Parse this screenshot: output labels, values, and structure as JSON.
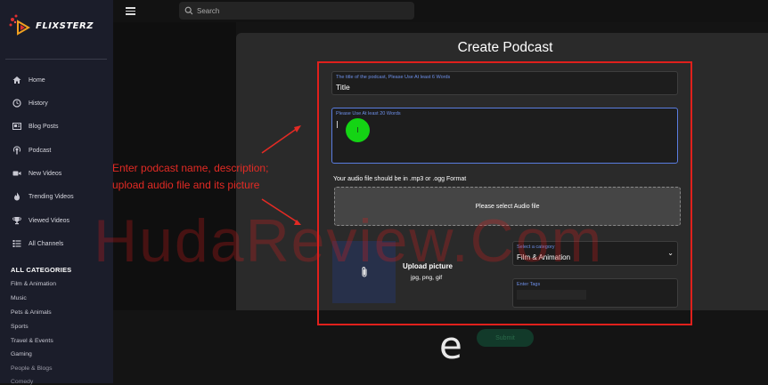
{
  "app": {
    "logo_text": "FLIXSTERZ"
  },
  "topbar": {
    "search_placeholder": "Search"
  },
  "sidebar": {
    "items": [
      {
        "label": "Home",
        "icon": "home-icon"
      },
      {
        "label": "History",
        "icon": "clock-icon"
      },
      {
        "label": "Blog Posts",
        "icon": "blog-icon"
      },
      {
        "label": "Podcast",
        "icon": "podcast-icon"
      },
      {
        "label": "New Videos",
        "icon": "video-camera-icon"
      },
      {
        "label": "Trending Videos",
        "icon": "flame-icon"
      },
      {
        "label": "Viewed Videos",
        "icon": "trophy-icon"
      },
      {
        "label": "All Channels",
        "icon": "list-icon"
      }
    ],
    "categories_title": "ALL CATEGORIES",
    "categories": [
      "Film & Animation",
      "Music",
      "Pets & Animals",
      "Sports",
      "Travel & Events",
      "Gaming",
      "People & Blogs",
      "Comedy"
    ]
  },
  "form": {
    "heading": "Create Podcast",
    "title_label": "The title of the podcast, Please Use At least 6 Words",
    "title_value": "Title",
    "description_label": "Please Use At least 20 Words",
    "cursor_glyph": "I",
    "audio_note": "Your audio file should be in .mp3 or .ogg Format",
    "audio_drop": "Please select Audio file",
    "upload_picture_title": "Upload picture",
    "upload_picture_formats": "jpg, png, gif",
    "category_label": "Select a category",
    "category_value": "Film & Animation",
    "tags_label": "Enter Tags",
    "submit_label": "Submit"
  },
  "annotation": {
    "line1": "Enter podcast name, description;",
    "line2": "upload audio file and its picture"
  },
  "watermark": "HudaReview.Com",
  "overlay_logo": "e",
  "colors": {
    "accent_red": "#e0201c",
    "label_blue": "#6d8fe8",
    "click_green": "#14d414",
    "sidebar_bg": "#1b1d2a"
  }
}
